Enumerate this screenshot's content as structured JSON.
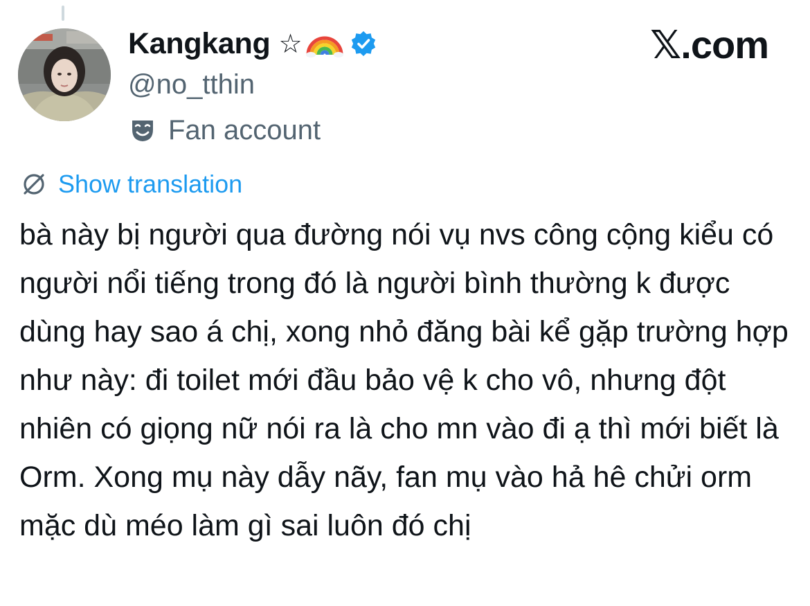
{
  "tweet": {
    "author": {
      "display_name": "Kangkang",
      "name_emojis": [
        "star-outline",
        "rainbow"
      ],
      "star_glyph": "☆",
      "verified": true,
      "handle": "@no_tthin",
      "category": "Fan account",
      "category_icon": "performing-arts-mask-icon"
    },
    "brand": "𝕏.com",
    "translation_link": "Show translation",
    "text": "bà này bị người qua đường nói vụ nvs công cộng kiểu có người nổi tiếng trong đó là người bình thường k được dùng hay sao á chị, xong nhỏ đăng bài kể gặp trường hợp như này: đi toilet mới đầu bảo vệ k cho vô, nhưng đột nhiên có giọng nữ nói ra là cho mn vào đi ạ thì mới biết là Orm. Xong mụ này dẫy nãy, fan mụ vào hả hê chửi orm mặc dù méo làm gì sai luôn đó chị"
  },
  "colors": {
    "text_primary": "#0f1419",
    "text_secondary": "#536471",
    "link": "#1d9bf0",
    "verified_badge": "#1d9bf0",
    "thread_line": "#cfd9de"
  }
}
